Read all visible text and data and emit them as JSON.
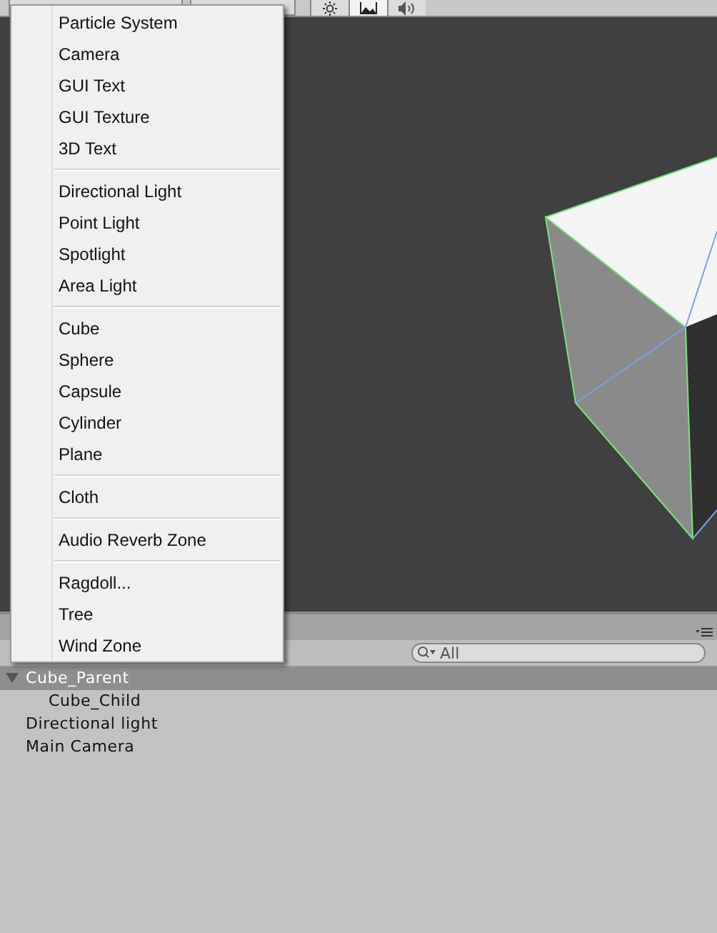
{
  "scene_toolbar": {
    "toggles": [
      {
        "kind": "lighting",
        "on": false
      },
      {
        "kind": "image",
        "on": true
      },
      {
        "kind": "audio",
        "on": false
      }
    ]
  },
  "create_menu": {
    "groups": [
      {
        "items": [
          "Particle System",
          "Camera",
          "GUI Text",
          "GUI Texture",
          "3D Text"
        ]
      },
      {
        "items": [
          "Directional Light",
          "Point Light",
          "Spotlight",
          "Area Light"
        ]
      },
      {
        "items": [
          "Cube",
          "Sphere",
          "Capsule",
          "Cylinder",
          "Plane"
        ]
      },
      {
        "items": [
          "Cloth"
        ]
      },
      {
        "items": [
          "Audio Reverb Zone"
        ]
      },
      {
        "items": [
          "Ragdoll...",
          "Tree",
          "Wind Zone"
        ]
      }
    ]
  },
  "hierarchy": {
    "search": {
      "placeholder": "All"
    },
    "items": [
      {
        "label": "Cube_Parent",
        "selected": true,
        "expanded": true,
        "children": [
          {
            "label": "Cube_Child",
            "selected": false
          }
        ]
      },
      {
        "label": "Directional light",
        "selected": false
      },
      {
        "label": "Main Camera",
        "selected": false
      }
    ]
  }
}
